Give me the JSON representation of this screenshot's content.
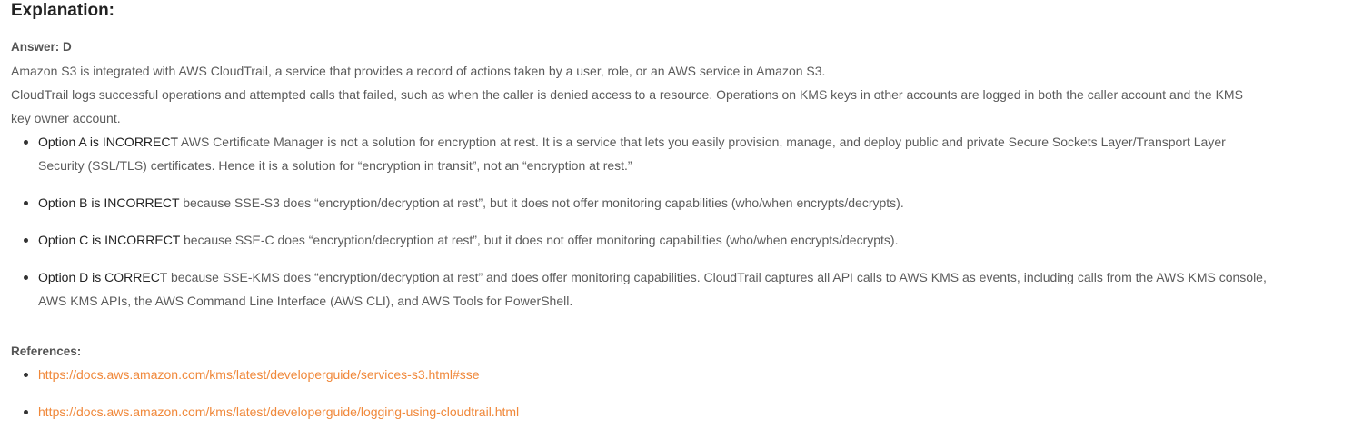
{
  "heading": "Explanation:",
  "answer": "Answer: D",
  "paragraphs": [
    "Amazon S3 is integrated with AWS CloudTrail, a service that provides a record of actions taken by a user, role, or an AWS service in Amazon S3.",
    "CloudTrail logs successful operations and attempted calls that failed, such as when the caller is denied access to a resource. Operations on KMS keys in other accounts are logged in both the caller account and the KMS key owner account."
  ],
  "options": [
    {
      "lead": "Option A is INCORRECT",
      "text": " AWS Certificate Manager is not a solution for encryption at rest. It is a service that lets you easily provision, manage, and deploy public and private Secure Sockets Layer/Transport Layer Security (SSL/TLS) certificates. Hence it is a solution for “encryption in transit”, not an “encryption at rest.”"
    },
    {
      "lead": "Option B is INCORRECT",
      "text": " because SSE-S3 does “encryption/decryption at rest”, but it does not offer monitoring capabilities (who/when encrypts/decrypts)."
    },
    {
      "lead": "Option C is INCORRECT",
      "text": " because SSE-C does “encryption/decryption at rest”, but it does not offer monitoring capabilities (who/when encrypts/decrypts)."
    },
    {
      "lead": "Option D is CORRECT",
      "text": " because SSE-KMS does “encryption/decryption at rest” and does offer monitoring capabilities. CloudTrail captures all API calls to AWS KMS as events, including calls from the AWS KMS console, AWS KMS APIs, the AWS Command Line Interface (AWS CLI), and AWS Tools for PowerShell."
    }
  ],
  "references_label": "References:",
  "references": [
    "https://docs.aws.amazon.com/kms/latest/developerguide/services-s3.html#sse",
    "https://docs.aws.amazon.com/kms/latest/developerguide/logging-using-cloudtrail.html"
  ],
  "colors": {
    "link": "#f0883a",
    "text": "#5b5b5b",
    "heading": "#222222"
  }
}
